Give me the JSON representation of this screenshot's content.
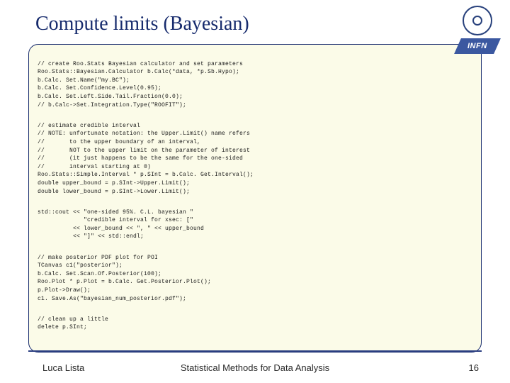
{
  "title": "Compute limits (Bayesian)",
  "logo": {
    "infn_text": "INFN"
  },
  "code": {
    "b1": "// create Roo.Stats Bayesian calculator and set parameters\nRoo.Stats::Bayesian.Calculator b.Calc(*data, *p.Sb.Hypo);\nb.Calc. Set.Name(\"my.BC\");\nb.Calc. Set.Confidence.Level(0.95);\nb.Calc. Set.Left.Side.Tail.Fraction(0.0);\n// b.Calc->Set.Integration.Type(\"ROOFIT\");",
    "b2": "// estimate credible interval\n// NOTE: unfortunate notation: the Upper.Limit() name refers\n//       to the upper boundary of an interval,\n//       NOT to the upper limit on the parameter of interest\n//       (it just happens to be the same for the one-sided\n//       interval starting at 0)\nRoo.Stats::Simple.Interval * p.SInt = b.Calc. Get.Interval();\ndouble upper_bound = p.SInt->Upper.Limit();\ndouble lower_bound = p.SInt->Lower.Limit();",
    "b3": "std::cout << \"one-sided 95%. C.L. bayesian \"\n             \"credible interval for xsec: [\"\n          << lower_bound << \", \" << upper_bound\n          << \"]\" << std::endl;",
    "b4": "// make posterior PDF plot for POI\nTCanvas c1(\"posterior\");\nb.Calc. Set.Scan.Of.Posterior(100);\nRoo.Plot * p.Plot = b.Calc. Get.Posterior.Plot();\np.Plot->Draw();\nc1. Save.As(\"bayesian_num_posterior.pdf\");",
    "b5": "// clean up a little\ndelete p.SInt;"
  },
  "footer": {
    "author": "Luca Lista",
    "center": "Statistical Methods for Data Analysis",
    "page": "16"
  }
}
